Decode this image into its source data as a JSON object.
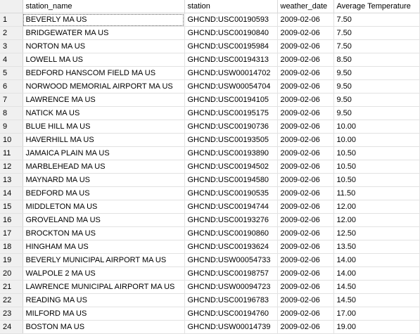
{
  "grid": {
    "columns": [
      {
        "key": "row",
        "label": ""
      },
      {
        "key": "station_name",
        "label": "station_name"
      },
      {
        "key": "station",
        "label": "station"
      },
      {
        "key": "weather_date",
        "label": "weather_date"
      },
      {
        "key": "avg_temp",
        "label": "Average Temperature"
      }
    ],
    "rows": [
      {
        "n": "1",
        "station_name": "BEVERLY MA US",
        "station": "GHCND:USC00190593",
        "weather_date": "2009-02-06",
        "avg_temp": "7.50"
      },
      {
        "n": "2",
        "station_name": "BRIDGEWATER MA US",
        "station": "GHCND:USC00190840",
        "weather_date": "2009-02-06",
        "avg_temp": "7.50"
      },
      {
        "n": "3",
        "station_name": "NORTON MA US",
        "station": "GHCND:USC00195984",
        "weather_date": "2009-02-06",
        "avg_temp": "7.50"
      },
      {
        "n": "4",
        "station_name": "LOWELL MA US",
        "station": "GHCND:USC00194313",
        "weather_date": "2009-02-06",
        "avg_temp": "8.50"
      },
      {
        "n": "5",
        "station_name": "BEDFORD HANSCOM FIELD MA US",
        "station": "GHCND:USW00014702",
        "weather_date": "2009-02-06",
        "avg_temp": "9.50"
      },
      {
        "n": "6",
        "station_name": "NORWOOD MEMORIAL AIRPORT MA US",
        "station": "GHCND:USW00054704",
        "weather_date": "2009-02-06",
        "avg_temp": "9.50"
      },
      {
        "n": "7",
        "station_name": "LAWRENCE MA US",
        "station": "GHCND:USC00194105",
        "weather_date": "2009-02-06",
        "avg_temp": "9.50"
      },
      {
        "n": "8",
        "station_name": "NATICK MA US",
        "station": "GHCND:USC00195175",
        "weather_date": "2009-02-06",
        "avg_temp": "9.50"
      },
      {
        "n": "9",
        "station_name": "BLUE HILL MA US",
        "station": "GHCND:USC00190736",
        "weather_date": "2009-02-06",
        "avg_temp": "10.00"
      },
      {
        "n": "10",
        "station_name": "HAVERHILL MA US",
        "station": "GHCND:USC00193505",
        "weather_date": "2009-02-06",
        "avg_temp": "10.00"
      },
      {
        "n": "11",
        "station_name": "JAMAICA PLAIN MA US",
        "station": "GHCND:USC00193890",
        "weather_date": "2009-02-06",
        "avg_temp": "10.50"
      },
      {
        "n": "12",
        "station_name": "MARBLEHEAD MA US",
        "station": "GHCND:USC00194502",
        "weather_date": "2009-02-06",
        "avg_temp": "10.50"
      },
      {
        "n": "13",
        "station_name": "MAYNARD MA US",
        "station": "GHCND:USC00194580",
        "weather_date": "2009-02-06",
        "avg_temp": "10.50"
      },
      {
        "n": "14",
        "station_name": "BEDFORD MA US",
        "station": "GHCND:USC00190535",
        "weather_date": "2009-02-06",
        "avg_temp": "11.50"
      },
      {
        "n": "15",
        "station_name": "MIDDLETON MA US",
        "station": "GHCND:USC00194744",
        "weather_date": "2009-02-06",
        "avg_temp": "12.00"
      },
      {
        "n": "16",
        "station_name": "GROVELAND MA US",
        "station": "GHCND:USC00193276",
        "weather_date": "2009-02-06",
        "avg_temp": "12.00"
      },
      {
        "n": "17",
        "station_name": "BROCKTON MA US",
        "station": "GHCND:USC00190860",
        "weather_date": "2009-02-06",
        "avg_temp": "12.50"
      },
      {
        "n": "18",
        "station_name": "HINGHAM MA US",
        "station": "GHCND:USC00193624",
        "weather_date": "2009-02-06",
        "avg_temp": "13.50"
      },
      {
        "n": "19",
        "station_name": "BEVERLY MUNICIPAL AIRPORT MA US",
        "station": "GHCND:USW00054733",
        "weather_date": "2009-02-06",
        "avg_temp": "14.00"
      },
      {
        "n": "20",
        "station_name": "WALPOLE 2 MA US",
        "station": "GHCND:USC00198757",
        "weather_date": "2009-02-06",
        "avg_temp": "14.00"
      },
      {
        "n": "21",
        "station_name": "LAWRENCE MUNICIPAL AIRPORT MA US",
        "station": "GHCND:USW00094723",
        "weather_date": "2009-02-06",
        "avg_temp": "14.50"
      },
      {
        "n": "22",
        "station_name": "READING MA US",
        "station": "GHCND:USC00196783",
        "weather_date": "2009-02-06",
        "avg_temp": "14.50"
      },
      {
        "n": "23",
        "station_name": "MILFORD MA US",
        "station": "GHCND:USC00194760",
        "weather_date": "2009-02-06",
        "avg_temp": "17.00"
      },
      {
        "n": "24",
        "station_name": "BOSTON MA US",
        "station": "GHCND:USW00014739",
        "weather_date": "2009-02-06",
        "avg_temp": "19.00"
      }
    ]
  }
}
